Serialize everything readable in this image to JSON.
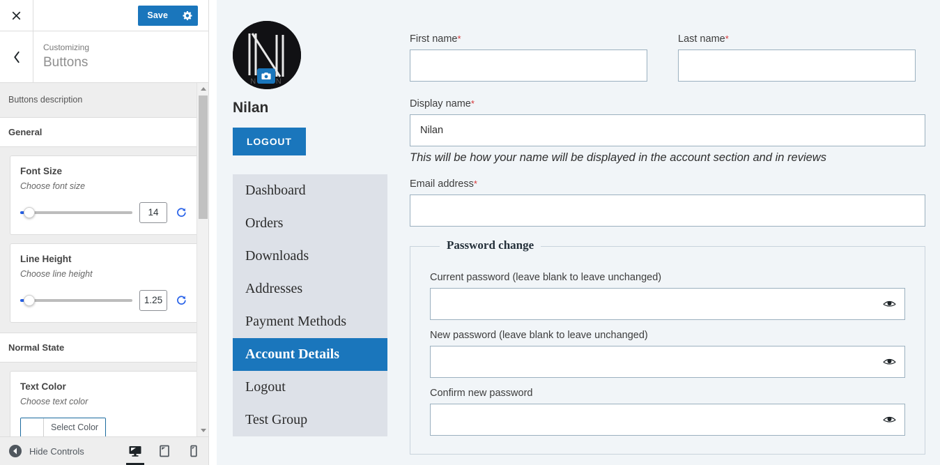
{
  "customizer": {
    "close_icon": "close-icon",
    "save_label": "Save",
    "gear_icon": "gear-icon",
    "back_icon": "chevron-left-icon",
    "parent_label": "Customizing",
    "panel_title": "Buttons",
    "description": "Buttons description",
    "sections": [
      {
        "label": "General"
      },
      {
        "label": "Normal State"
      }
    ],
    "controls": {
      "font_size": {
        "title": "Font Size",
        "sub": "Choose font size",
        "value": "14",
        "reset_icon": "reset-icon"
      },
      "line_height": {
        "title": "Line Height",
        "sub": "Choose line height",
        "value": "1.25",
        "reset_icon": "reset-icon"
      },
      "text_color": {
        "title": "Text Color",
        "sub": "Choose text color",
        "button_label": "Select Color",
        "swatch": "#ffffff"
      }
    },
    "footer": {
      "hide_controls_label": "Hide Controls",
      "hide_icon": "collapse-icon",
      "devices": [
        {
          "name": "desktop",
          "icon": "desktop-icon",
          "active": true
        },
        {
          "name": "tablet",
          "icon": "tablet-icon",
          "active": false
        },
        {
          "name": "mobile",
          "icon": "mobile-icon",
          "active": false
        }
      ]
    },
    "accent_color": "#1a76bc"
  },
  "preview": {
    "account": {
      "avatar_alt": "avatar-image",
      "camera_icon": "camera-icon",
      "display_name": "Nilan",
      "logout_button": "LOGOUT",
      "nav": [
        {
          "label": "Dashboard",
          "active": false
        },
        {
          "label": "Orders",
          "active": false
        },
        {
          "label": "Downloads",
          "active": false
        },
        {
          "label": "Addresses",
          "active": false
        },
        {
          "label": "Payment Methods",
          "active": false
        },
        {
          "label": "Account Details",
          "active": true
        },
        {
          "label": "Logout",
          "active": false
        },
        {
          "label": "Test Group",
          "active": false
        }
      ]
    },
    "form": {
      "first_name": {
        "label": "First name",
        "required": "*",
        "value": ""
      },
      "last_name": {
        "label": "Last name",
        "required": "*",
        "value": ""
      },
      "display_name": {
        "label": "Display name",
        "required": "*",
        "value": "Nilan",
        "hint": "This will be how your name will be displayed in the account section and in reviews"
      },
      "email": {
        "label": "Email address",
        "required": "*",
        "value": ""
      },
      "password_fieldset": {
        "legend": "Password change",
        "current": {
          "label": "Current password (leave blank to leave unchanged)",
          "value": "",
          "eye_icon": "eye-icon"
        },
        "new": {
          "label": "New password (leave blank to leave unchanged)",
          "value": "",
          "eye_icon": "eye-icon"
        },
        "confirm": {
          "label": "Confirm new password",
          "value": "",
          "eye_icon": "eye-icon"
        }
      }
    }
  }
}
